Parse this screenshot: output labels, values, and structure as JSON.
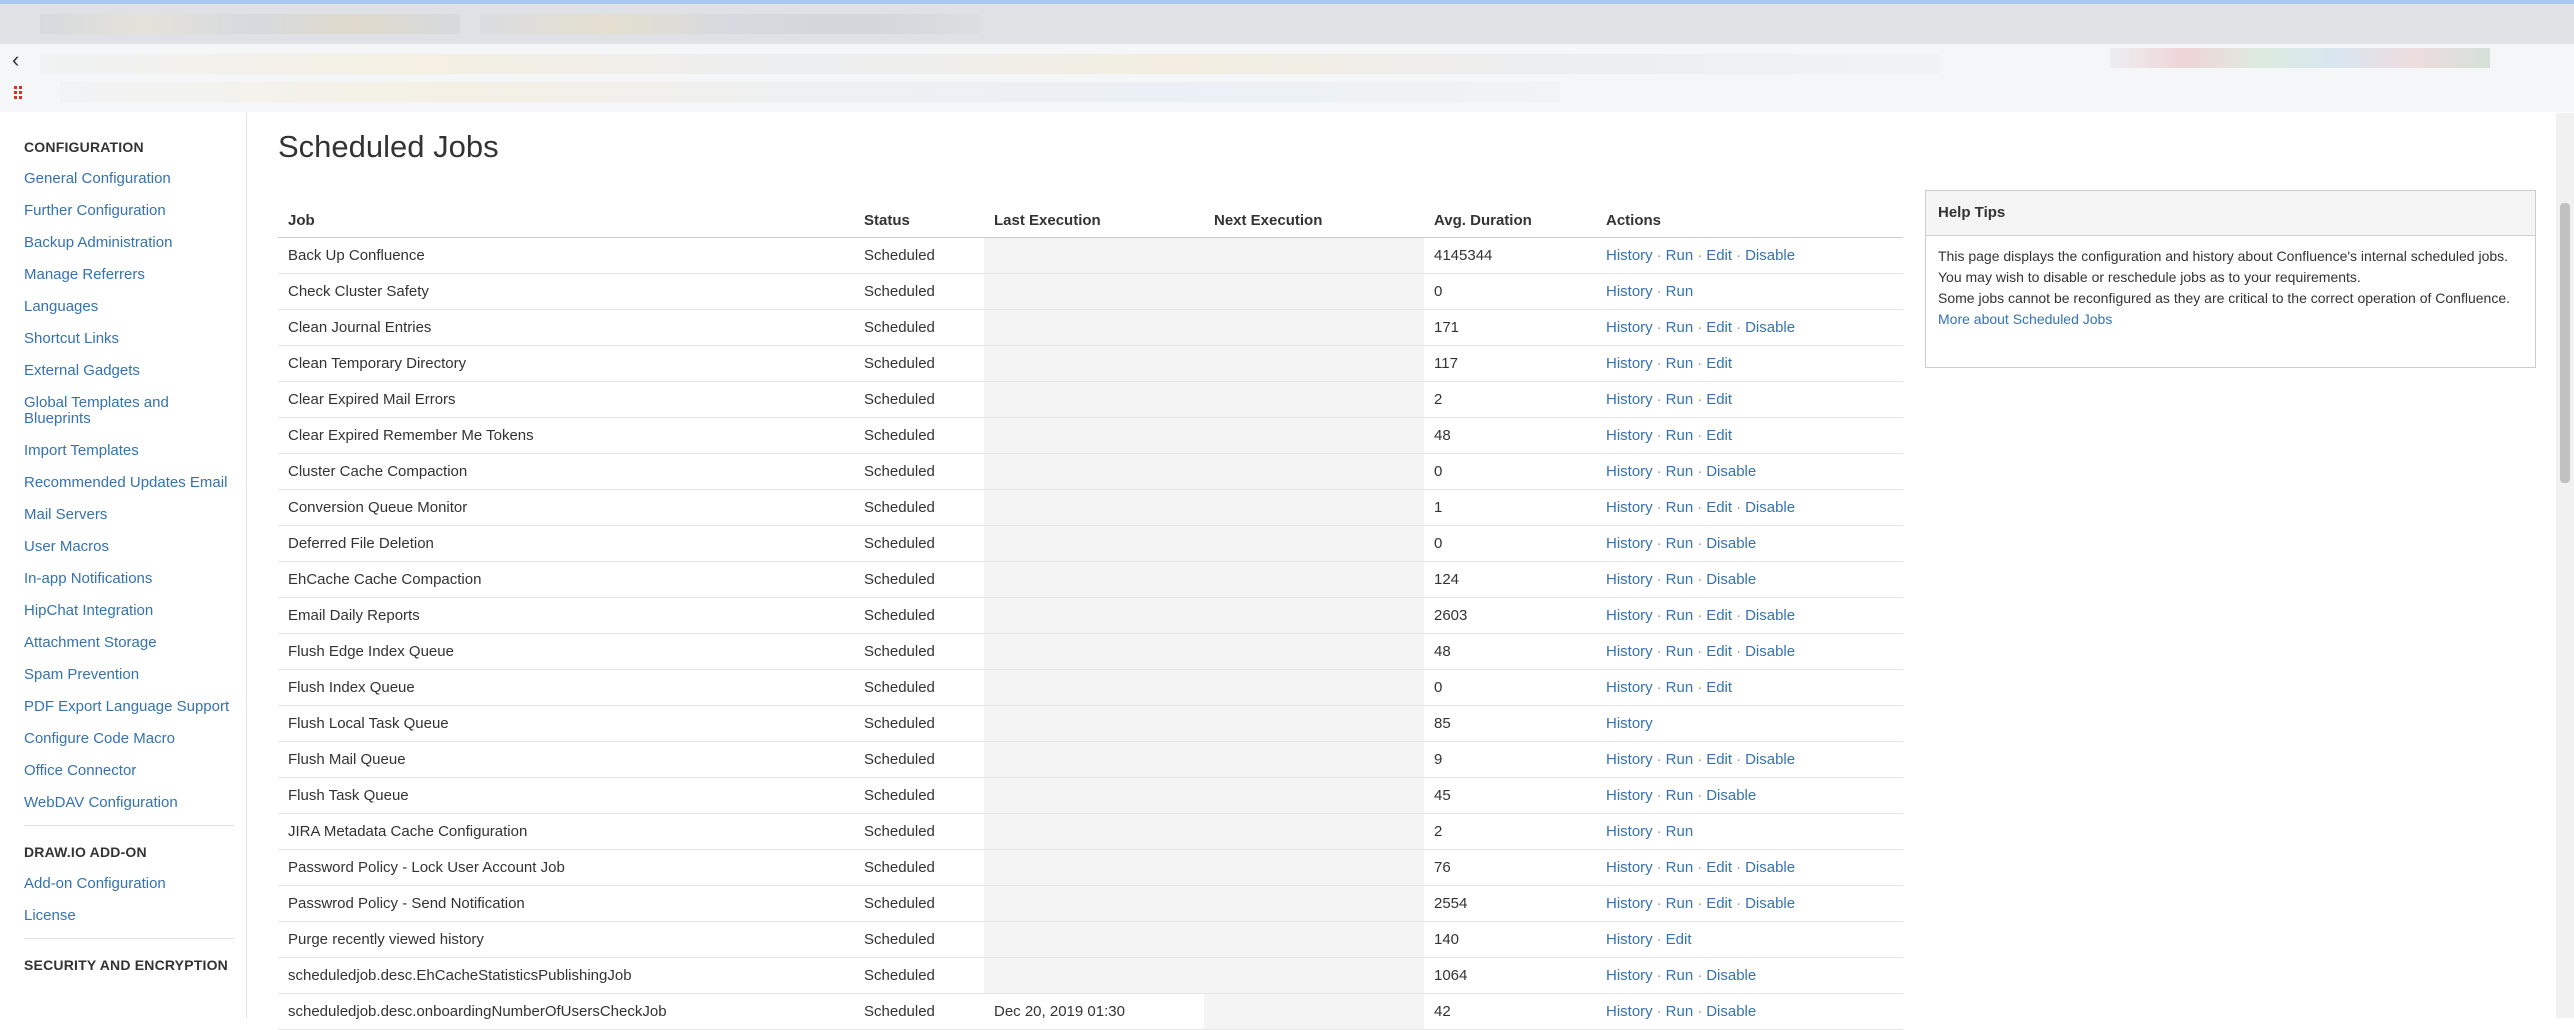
{
  "sidebar": {
    "sections": [
      {
        "title": "CONFIGURATION",
        "items": [
          "General Configuration",
          "Further Configuration",
          "Backup Administration",
          "Manage Referrers",
          "Languages",
          "Shortcut Links",
          "External Gadgets",
          "Global Templates and Blueprints",
          "Import Templates",
          "Recommended Updates Email",
          "Mail Servers",
          "User Macros",
          "In-app Notifications",
          "HipChat Integration",
          "Attachment Storage",
          "Spam Prevention",
          "PDF Export Language Support",
          "Configure Code Macro",
          "Office Connector",
          "WebDAV Configuration"
        ]
      },
      {
        "title": "DRAW.IO ADD-ON",
        "items": [
          "Add-on Configuration",
          "License"
        ]
      },
      {
        "title": "SECURITY AND ENCRYPTION",
        "items": []
      }
    ]
  },
  "main": {
    "title": "Scheduled Jobs",
    "columns": [
      "Job",
      "Status",
      "Last Execution",
      "Next Execution",
      "Avg. Duration",
      "Actions"
    ],
    "rows": [
      {
        "job": "Back Up Confluence",
        "status": "Scheduled",
        "last": "",
        "next": "",
        "avg": "4145344",
        "actions": [
          "History",
          "Run",
          "Edit",
          "Disable"
        ]
      },
      {
        "job": "Check Cluster Safety",
        "status": "Scheduled",
        "last": "",
        "next": "",
        "avg": "0",
        "actions": [
          "History",
          "Run"
        ]
      },
      {
        "job": "Clean Journal Entries",
        "status": "Scheduled",
        "last": "",
        "next": "",
        "avg": "171",
        "actions": [
          "History",
          "Run",
          "Edit",
          "Disable"
        ]
      },
      {
        "job": "Clean Temporary Directory",
        "status": "Scheduled",
        "last": "",
        "next": "",
        "avg": "117",
        "actions": [
          "History",
          "Run",
          "Edit"
        ]
      },
      {
        "job": "Clear Expired Mail Errors",
        "status": "Scheduled",
        "last": "",
        "next": "",
        "avg": "2",
        "actions": [
          "History",
          "Run",
          "Edit"
        ]
      },
      {
        "job": "Clear Expired Remember Me Tokens",
        "status": "Scheduled",
        "last": "",
        "next": "",
        "avg": "48",
        "actions": [
          "History",
          "Run",
          "Edit"
        ]
      },
      {
        "job": "Cluster Cache Compaction",
        "status": "Scheduled",
        "last": "",
        "next": "",
        "avg": "0",
        "actions": [
          "History",
          "Run",
          "Disable"
        ]
      },
      {
        "job": "Conversion Queue Monitor",
        "status": "Scheduled",
        "last": "",
        "next": "",
        "avg": "1",
        "actions": [
          "History",
          "Run",
          "Edit",
          "Disable"
        ]
      },
      {
        "job": "Deferred File Deletion",
        "status": "Scheduled",
        "last": "",
        "next": "",
        "avg": "0",
        "actions": [
          "History",
          "Run",
          "Disable"
        ]
      },
      {
        "job": "EhCache Cache Compaction",
        "status": "Scheduled",
        "last": "",
        "next": "",
        "avg": "124",
        "actions": [
          "History",
          "Run",
          "Disable"
        ]
      },
      {
        "job": "Email Daily Reports",
        "status": "Scheduled",
        "last": "",
        "next": "",
        "avg": "2603",
        "actions": [
          "History",
          "Run",
          "Edit",
          "Disable"
        ]
      },
      {
        "job": "Flush Edge Index Queue",
        "status": "Scheduled",
        "last": "",
        "next": "",
        "avg": "48",
        "actions": [
          "History",
          "Run",
          "Edit",
          "Disable"
        ]
      },
      {
        "job": "Flush Index Queue",
        "status": "Scheduled",
        "last": "",
        "next": "",
        "avg": "0",
        "actions": [
          "History",
          "Run",
          "Edit"
        ]
      },
      {
        "job": "Flush Local Task Queue",
        "status": "Scheduled",
        "last": "",
        "next": "",
        "avg": "85",
        "actions": [
          "History"
        ]
      },
      {
        "job": "Flush Mail Queue",
        "status": "Scheduled",
        "last": "",
        "next": "",
        "avg": "9",
        "actions": [
          "History",
          "Run",
          "Edit",
          "Disable"
        ]
      },
      {
        "job": "Flush Task Queue",
        "status": "Scheduled",
        "last": "",
        "next": "",
        "avg": "45",
        "actions": [
          "History",
          "Run",
          "Disable"
        ]
      },
      {
        "job": "JIRA Metadata Cache Configuration",
        "status": "Scheduled",
        "last": "",
        "next": "",
        "avg": "2",
        "actions": [
          "History",
          "Run"
        ]
      },
      {
        "job": "Password Policy - Lock User Account Job",
        "status": "Scheduled",
        "last": "",
        "next": "",
        "avg": "76",
        "actions": [
          "History",
          "Run",
          "Edit",
          "Disable"
        ]
      },
      {
        "job": "Passwrod Policy - Send Notification",
        "status": "Scheduled",
        "last": "",
        "next": "",
        "avg": "2554",
        "actions": [
          "History",
          "Run",
          "Edit",
          "Disable"
        ]
      },
      {
        "job": "Purge recently viewed history",
        "status": "Scheduled",
        "last": "",
        "next": "",
        "avg": "140",
        "actions": [
          "History",
          "Edit"
        ]
      },
      {
        "job": "scheduledjob.desc.EhCacheStatisticsPublishingJob",
        "status": "Scheduled",
        "last": "",
        "next": "",
        "avg": "1064",
        "actions": [
          "History",
          "Run",
          "Disable"
        ]
      },
      {
        "job": "scheduledjob.desc.onboardingNumberOfUsersCheckJob",
        "status": "Scheduled",
        "last": "Dec 20, 2019 01:30",
        "next": "",
        "avg": "42",
        "actions": [
          "History",
          "Run",
          "Disable"
        ]
      }
    ]
  },
  "help": {
    "title": "Help Tips",
    "lines": [
      "This page displays the configuration and history about Confluence's internal scheduled jobs.",
      "You may wish to disable or reschedule jobs as to your requirements.",
      "Some jobs cannot be reconfigured as they are critical to the correct operation of Confluence."
    ],
    "link": "More about Scheduled Jobs"
  },
  "chrome": {
    "back_icon": "arrow-left-icon",
    "apps_icon": "apps-grid-icon"
  },
  "colors": {
    "link": "#3572b0",
    "text": "#333333",
    "border": "#cccccc"
  }
}
